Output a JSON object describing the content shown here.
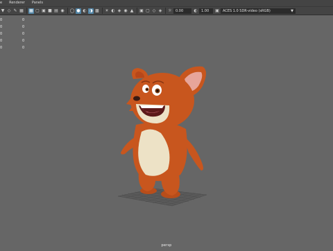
{
  "menubar": {
    "items": [
      "e",
      "Renderer",
      "Panels"
    ]
  },
  "toolbar": {
    "exposure_value": "0.00",
    "gamma_value": "1.00",
    "color_space": "ACES 1.0 SDR-video (sRGB)",
    "icons": [
      "view-select-icon",
      "camera-attributes-icon",
      "bookmark-icon",
      "image-plane-icon",
      "grid-icon",
      "film-gate-icon",
      "resolution-gate-icon",
      "gate-mask-icon",
      "field-chart-icon",
      "safe-action-icon",
      "wireframe-icon",
      "smooth-shade-icon",
      "default-material-icon",
      "wireframe-on-shaded-icon",
      "textured-icon",
      "use-all-lights-icon",
      "shadows-icon",
      "ambient-occlusion-icon",
      "motion-blur-icon",
      "anti-aliasing-icon",
      "isolate-select-icon",
      "xray-icon",
      "xray-joints-icon",
      "xray-components-icon",
      "exposure-icon",
      "gamma-icon"
    ]
  },
  "hud": {
    "rows": [
      {
        "a": "0",
        "b": "0"
      },
      {
        "a": "0",
        "b": "0"
      },
      {
        "a": "0",
        "b": "0"
      },
      {
        "a": "0",
        "b": "0"
      },
      {
        "a": "0",
        "b": "0"
      }
    ]
  },
  "viewport": {
    "camera": "persp",
    "background": "#666666"
  },
  "colors": {
    "fur": "#c8561e",
    "belly": "#ede2c6",
    "panel": "#444444"
  }
}
